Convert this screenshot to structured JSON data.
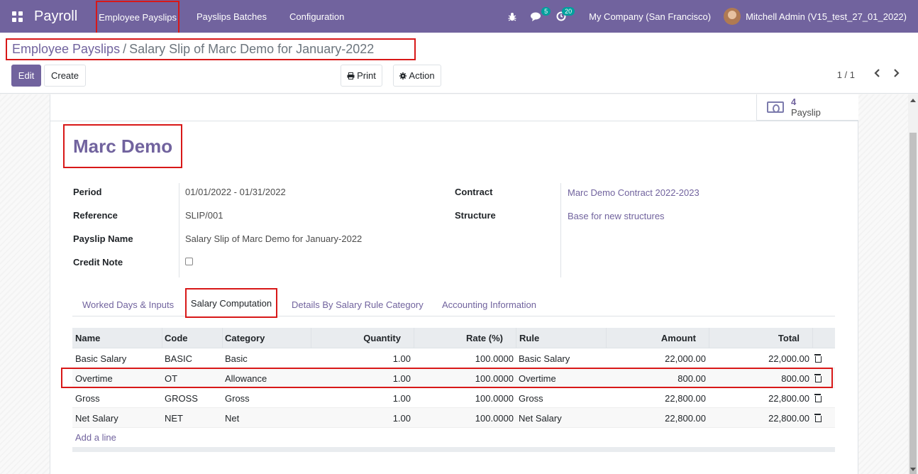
{
  "navbar": {
    "app_name": "Payroll",
    "menu": [
      "Employee Payslips",
      "Payslips Batches",
      "Configuration"
    ],
    "messages_count": "5",
    "activities_count": "20",
    "company": "My Company (San Francisco)",
    "user": "Mitchell Admin (V15_test_27_01_2022)"
  },
  "breadcrumb": {
    "parent": "Employee Payslips",
    "separator": "/",
    "current": "Salary Slip of Marc Demo for January-2022"
  },
  "toolbar": {
    "edit": "Edit",
    "create": "Create",
    "print": "Print",
    "action": "Action",
    "pager": "1 / 1"
  },
  "smart_button": {
    "count": "4",
    "label": "Payslip"
  },
  "form": {
    "employee_name": "Marc Demo",
    "period_label": "Period",
    "period_value": "01/01/2022 - 01/31/2022",
    "reference_label": "Reference",
    "reference_value": "SLIP/001",
    "payslip_name_label": "Payslip Name",
    "payslip_name_value": "Salary Slip of Marc Demo for January-2022",
    "credit_note_label": "Credit Note",
    "contract_label": "Contract",
    "contract_value": "Marc Demo Contract 2022-2023",
    "structure_label": "Structure",
    "structure_value": "Base for new structures"
  },
  "tabs": [
    "Worked Days & Inputs",
    "Salary Computation",
    "Details By Salary Rule Category",
    "Accounting Information"
  ],
  "table": {
    "headers": [
      "Name",
      "Code",
      "Category",
      "Quantity",
      "Rate (%)",
      "Rule",
      "Amount",
      "Total"
    ],
    "rows": [
      [
        "Basic Salary",
        "BASIC",
        "Basic",
        "1.00",
        "100.0000",
        "Basic Salary",
        "22,000.00",
        "22,000.00"
      ],
      [
        "Overtime",
        "OT",
        "Allowance",
        "1.00",
        "100.0000",
        "Overtime",
        "800.00",
        "800.00"
      ],
      [
        "Gross",
        "GROSS",
        "Gross",
        "1.00",
        "100.0000",
        "Gross",
        "22,800.00",
        "22,800.00"
      ],
      [
        "Net Salary",
        "NET",
        "Net",
        "1.00",
        "100.0000",
        "Net Salary",
        "22,800.00",
        "22,800.00"
      ]
    ],
    "add_line": "Add a line"
  }
}
